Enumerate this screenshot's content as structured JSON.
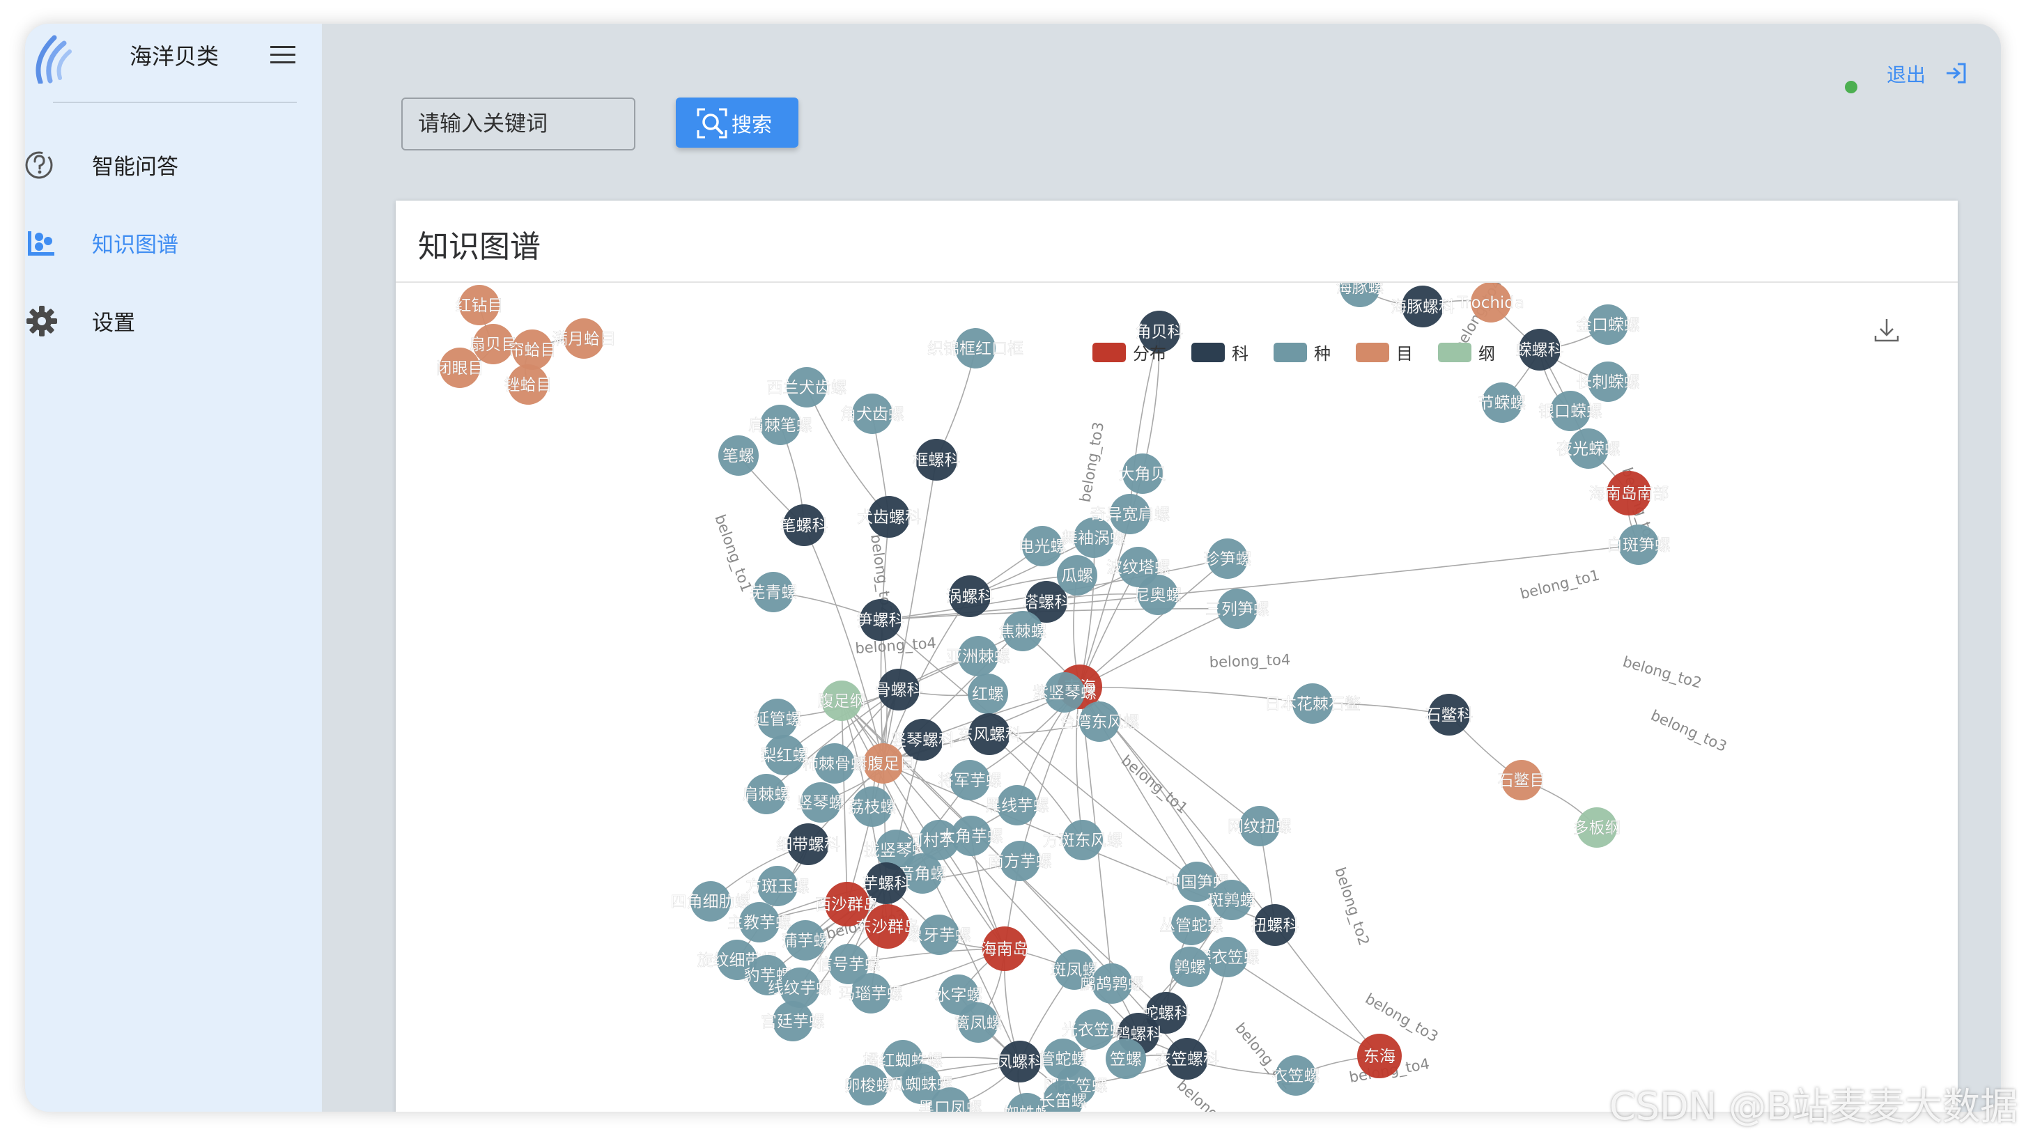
{
  "brand": {
    "title": "海洋贝类"
  },
  "sidebar": {
    "items": [
      {
        "label": "智能问答",
        "icon": "question-circle-icon",
        "active": false
      },
      {
        "label": "知识图谱",
        "icon": "graph-nodes-icon",
        "active": true
      },
      {
        "label": "设置",
        "icon": "gear-icon",
        "active": false
      }
    ]
  },
  "search": {
    "placeholder": "请输入关键词",
    "button_label": "搜索"
  },
  "header": {
    "logout_label": "退出"
  },
  "panel": {
    "title": "知识图谱"
  },
  "colors": {
    "accent": "#3d8ef0",
    "distribution": "#c0392b",
    "family": "#2c3e50",
    "species": "#6f98a4",
    "order": "#d48a68",
    "class": "#9cc4a6"
  },
  "graph": {
    "legend": [
      {
        "label": "分布",
        "category": "distribution"
      },
      {
        "label": "科",
        "category": "family"
      },
      {
        "label": "种",
        "category": "species"
      },
      {
        "label": "目",
        "category": "order"
      },
      {
        "label": "纲",
        "category": "class"
      }
    ],
    "nodes": [
      {
        "id": "扇贝目",
        "category": "order"
      },
      {
        "id": "帘蛤目",
        "category": "order"
      },
      {
        "id": "满月蛤目",
        "category": "order"
      },
      {
        "id": "闭眼目",
        "category": "order"
      },
      {
        "id": "锉蛤目",
        "category": "order"
      },
      {
        "id": "红钻目",
        "category": "order"
      },
      {
        "id": "织锦框红口框",
        "category": "species"
      },
      {
        "id": "西兰犬齿螺",
        "category": "species"
      },
      {
        "id": "角犬齿螺",
        "category": "species"
      },
      {
        "id": "肩棘笔螺",
        "category": "species"
      },
      {
        "id": "笔螺",
        "category": "species"
      },
      {
        "id": "框螺科",
        "category": "family"
      },
      {
        "id": "笔螺科",
        "category": "family"
      },
      {
        "id": "犬齿螺科",
        "category": "family"
      },
      {
        "id": "芜青螺",
        "category": "species"
      },
      {
        "id": "笋螺科",
        "category": "family"
      },
      {
        "id": "涡螺科",
        "category": "family"
      },
      {
        "id": "塔螺科",
        "category": "family"
      },
      {
        "id": "电光螺",
        "category": "species"
      },
      {
        "id": "舞袖涡螺",
        "category": "species"
      },
      {
        "id": "瓜螺",
        "category": "species"
      },
      {
        "id": "波纹塔螺",
        "category": "species"
      },
      {
        "id": "尼奥螺",
        "category": "species"
      },
      {
        "id": "珍笋螺",
        "category": "species"
      },
      {
        "id": "三列笋螺",
        "category": "species"
      },
      {
        "id": "焦棘螺",
        "category": "species"
      },
      {
        "id": "亚洲棘螺",
        "category": "species"
      },
      {
        "id": "南海",
        "category": "distribution"
      },
      {
        "id": "骨螺科",
        "category": "family"
      },
      {
        "id": "红螺",
        "category": "species"
      },
      {
        "id": "紫竖琴螺",
        "category": "species"
      },
      {
        "id": "台湾东风螺",
        "category": "species"
      },
      {
        "id": "腹足纲",
        "category": "class"
      },
      {
        "id": "延管螺",
        "category": "species"
      },
      {
        "id": "梨红螺",
        "category": "species"
      },
      {
        "id": "竖琴螺科",
        "category": "family"
      },
      {
        "id": "东风螺科",
        "category": "family"
      },
      {
        "id": "新腹足目",
        "category": "order"
      },
      {
        "id": "柿棘骨螺",
        "category": "species"
      },
      {
        "id": "肩棘螺",
        "category": "species"
      },
      {
        "id": "竖琴螺",
        "category": "species"
      },
      {
        "id": "荔枝螺",
        "category": "species"
      },
      {
        "id": "将军芋螺",
        "category": "species"
      },
      {
        "id": "黑线芋螺",
        "category": "species"
      },
      {
        "id": "细带螺科",
        "category": "family"
      },
      {
        "id": "拢竖琴螺",
        "category": "species"
      },
      {
        "id": "河村芋螺",
        "category": "species"
      },
      {
        "id": "大角芋螺",
        "category": "species"
      },
      {
        "id": "南方芋螺",
        "category": "species"
      },
      {
        "id": "方斑东风螺",
        "category": "species"
      },
      {
        "id": "音角螺",
        "category": "species"
      },
      {
        "id": "芋螺科",
        "category": "family"
      },
      {
        "id": "方斑玉螺",
        "category": "species"
      },
      {
        "id": "四角细肋螺",
        "category": "species"
      },
      {
        "id": "西沙群岛",
        "category": "distribution"
      },
      {
        "id": "主教芋螺",
        "category": "species"
      },
      {
        "id": "东沙群岛",
        "category": "distribution"
      },
      {
        "id": "蒲芋螺",
        "category": "species"
      },
      {
        "id": "旋纹细带螺",
        "category": "species"
      },
      {
        "id": "豹芋螺",
        "category": "species"
      },
      {
        "id": "信号芋螺",
        "category": "species"
      },
      {
        "id": "象牙芋螺",
        "category": "species"
      },
      {
        "id": "线纹芋螺",
        "category": "species"
      },
      {
        "id": "玛瑙芋螺",
        "category": "species"
      },
      {
        "id": "宫廷芋螺",
        "category": "species"
      },
      {
        "id": "海南岛",
        "category": "distribution"
      },
      {
        "id": "中国笋螺",
        "category": "species"
      },
      {
        "id": "斑鹑螺",
        "category": "species"
      },
      {
        "id": "丛管蛇螺",
        "category": "species"
      },
      {
        "id": "扭螺科",
        "category": "family"
      },
      {
        "id": "网纹扭螺",
        "category": "species"
      },
      {
        "id": "日本花棘石鳖",
        "category": "species"
      },
      {
        "id": "石鳖科",
        "category": "family"
      },
      {
        "id": "石鳖目",
        "category": "order"
      },
      {
        "id": "多板纲",
        "category": "class"
      },
      {
        "id": "斑凤螺",
        "category": "species"
      },
      {
        "id": "鹧鸪鹑螺",
        "category": "species"
      },
      {
        "id": "缀衣笠螺",
        "category": "species"
      },
      {
        "id": "鹑螺",
        "category": "species"
      },
      {
        "id": "蛇螺科",
        "category": "family"
      },
      {
        "id": "光衣笠螺",
        "category": "species"
      },
      {
        "id": "鹑螺科",
        "category": "family"
      },
      {
        "id": "东海",
        "category": "distribution"
      },
      {
        "id": "衣笠螺科",
        "category": "family"
      },
      {
        "id": "衣笠螺",
        "category": "species"
      },
      {
        "id": "管蛇螺",
        "category": "species"
      },
      {
        "id": "笠螺",
        "category": "species"
      },
      {
        "id": "凤螺科",
        "category": "family"
      },
      {
        "id": "篱凤螺",
        "category": "species"
      },
      {
        "id": "水字螺",
        "category": "species"
      },
      {
        "id": "橘红蜘蛛螺",
        "category": "species"
      },
      {
        "id": "瓜蜘蛛螺",
        "category": "species"
      },
      {
        "id": "卵梭螺",
        "category": "species"
      },
      {
        "id": "黑口凤螺",
        "category": "species"
      },
      {
        "id": "蜘蛛螺",
        "category": "species"
      },
      {
        "id": "阳衣笠螺",
        "category": "species"
      },
      {
        "id": "长笛螺",
        "category": "species"
      },
      {
        "id": "海豚螺",
        "category": "species"
      },
      {
        "id": "海豚螺科",
        "category": "family"
      },
      {
        "id": "Trochida",
        "category": "order"
      },
      {
        "id": "金口蝾螺",
        "category": "species"
      },
      {
        "id": "蝾螺科",
        "category": "family"
      },
      {
        "id": "长刺蝾螺",
        "category": "species"
      },
      {
        "id": "节蝾螺",
        "category": "species"
      },
      {
        "id": "银口蝾螺",
        "category": "species"
      },
      {
        "id": "夜光蝾螺",
        "category": "species"
      },
      {
        "id": "海南岛南部",
        "category": "distribution"
      },
      {
        "id": "白斑笋螺",
        "category": "species"
      },
      {
        "id": "大角贝",
        "category": "species"
      },
      {
        "id": "奇异宽肩螺",
        "category": "species"
      },
      {
        "id": "角贝科",
        "category": "family"
      }
    ],
    "edge_label": "belong_to",
    "edges": [
      {
        "label": "belong_to1"
      },
      {
        "label": "belong_to2"
      },
      {
        "label": "belong_to3"
      },
      {
        "label": "belong_to4"
      }
    ]
  }
}
